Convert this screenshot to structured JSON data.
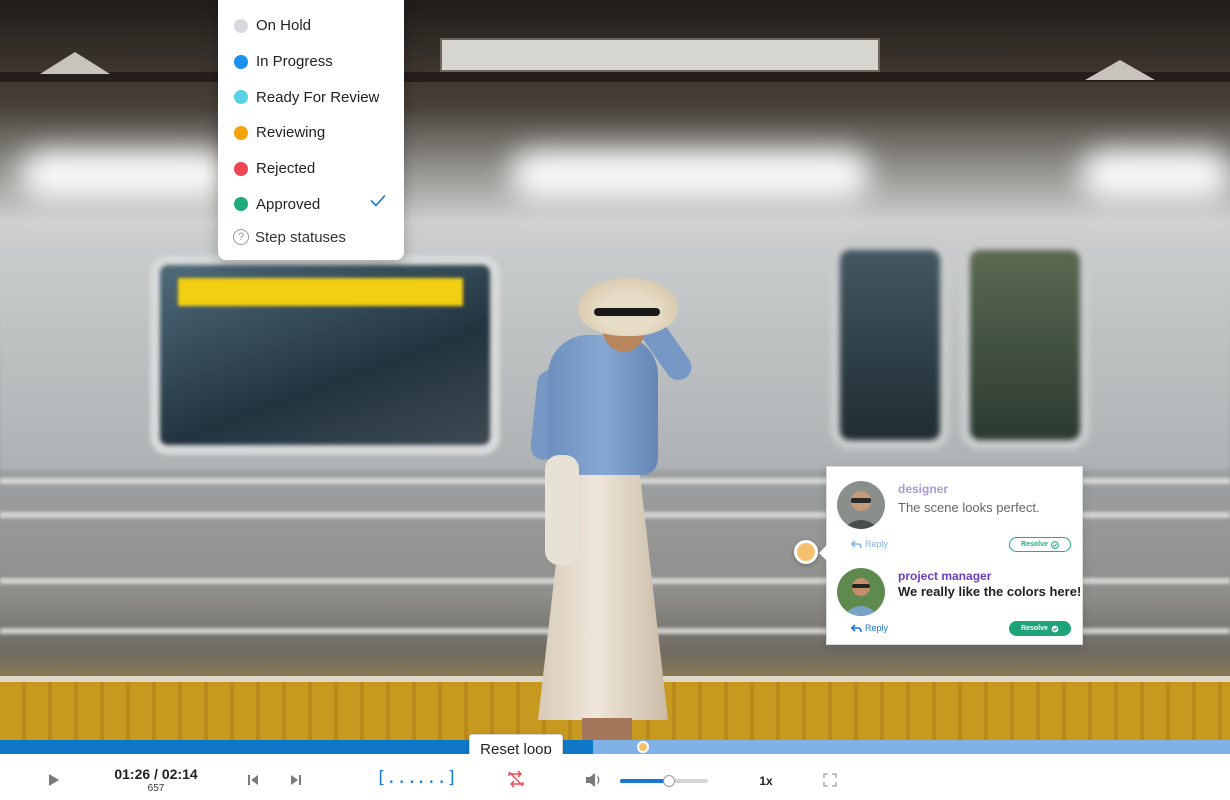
{
  "status_menu": {
    "items": [
      {
        "label": "On Hold",
        "color": "#d9d9dd"
      },
      {
        "label": "In Progress",
        "color": "#1a91f0"
      },
      {
        "label": "Ready For Review",
        "color": "#5bd1e6"
      },
      {
        "label": "Reviewing",
        "color": "#f5a30b"
      },
      {
        "label": "Rejected",
        "color": "#ef4652"
      },
      {
        "label": "Approved",
        "color": "#1eaa7c",
        "selected": true
      }
    ],
    "help_label": "Step statuses",
    "check_color": "#1677d6"
  },
  "comments": [
    {
      "author": "designer",
      "author_color": "#a99bd6",
      "text": "The scene looks perfect.",
      "text_color": "#666666",
      "reply_label": "Reply",
      "resolve_label": "Resolve",
      "resolved": false
    },
    {
      "author": "project manager",
      "author_color": "#6b3fc4",
      "text": "We really like the colors here!",
      "text_color": "#222222",
      "reply_label": "Reply",
      "resolve_label": "Resolve",
      "resolved": true
    }
  ],
  "player": {
    "current_time": "01:26",
    "separator": " / ",
    "duration": "02:14",
    "frame": "657",
    "progress_fraction": 0.482,
    "comment_marker_fraction": 0.523,
    "loop_in_label": "[...",
    "loop_out_label": "...]",
    "reset_loop_tooltip": "Reset loop",
    "volume_fraction": 0.56,
    "speed_label": "1x",
    "accent_color": "#1677d6",
    "seek_fill_color": "#0f78c8",
    "seek_track_color": "#80b2e8"
  }
}
